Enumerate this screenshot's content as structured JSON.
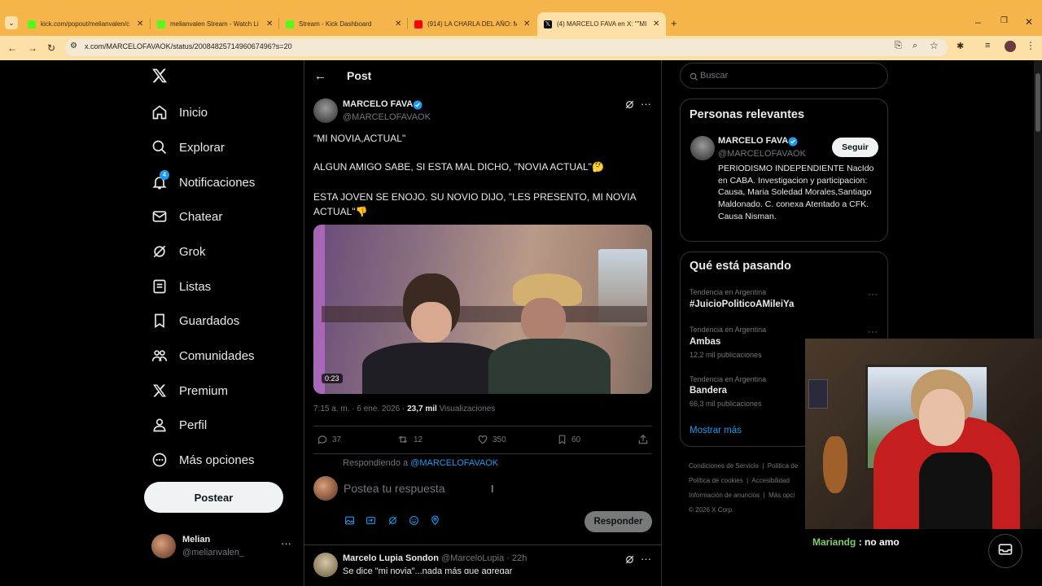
{
  "browser": {
    "tabs": [
      {
        "title": "kick.com/popout/melianvalen/c",
        "favicon": "kick"
      },
      {
        "title": "melianvalen Stream - Watch Li",
        "favicon": "kick"
      },
      {
        "title": "Stream - Kick Dashboard",
        "favicon": "kick"
      },
      {
        "title": "(914) LA CHARLA DEL AÑO: MI",
        "favicon": "youtube"
      },
      {
        "title": "(4) MARCELO FAVA en X: \"\"MI N",
        "favicon": "x"
      }
    ],
    "url": "x.com/MARCELOFAVAOK/status/2008482571496067496?s=20"
  },
  "sidebar": {
    "items": [
      {
        "label": "Inicio",
        "icon": "home-icon"
      },
      {
        "label": "Explorar",
        "icon": "search-icon"
      },
      {
        "label": "Notificaciones",
        "icon": "bell-icon",
        "badge": "4"
      },
      {
        "label": "Chatear",
        "icon": "mail-icon"
      },
      {
        "label": "Grok",
        "icon": "grok-icon"
      },
      {
        "label": "Listas",
        "icon": "list-icon"
      },
      {
        "label": "Guardados",
        "icon": "bookmark-icon"
      },
      {
        "label": "Comunidades",
        "icon": "communities-icon"
      },
      {
        "label": "Premium",
        "icon": "x-icon"
      },
      {
        "label": "Perfil",
        "icon": "profile-icon"
      },
      {
        "label": "Más opciones",
        "icon": "more-circle-icon"
      }
    ],
    "post_button": "Postear",
    "account": {
      "name": "Melian",
      "handle": "@melianvalen_"
    }
  },
  "main": {
    "header": "Post",
    "tweet": {
      "author": "MARCELO FAVA",
      "handle": "@MARCELOFAVAOK",
      "line1": "\"MI NOVIA,ACTUAL\"",
      "line2": "ALGUN AMIGO SABE, SI ESTA MAL DICHO, \"NOVIA ACTUAL\"🤔",
      "line3": "ESTA  JOVEN SE ENOJO. SU NOVIO DIJO, \"LES PRESENTO, MI NOVIA ACTUAL\"👎",
      "video_duration": "0:23",
      "timestamp": "7:15 a. m. · 6 ene. 2026 ·",
      "views_count": "23,7 mil",
      "views_label": "Visualizaciones",
      "replies": "37",
      "retweets": "12",
      "likes": "350",
      "bookmarks": "60"
    },
    "reply": {
      "replying_to_label": "Respondiendo a",
      "replying_to_handle": "@MARCELOFAVAOK",
      "placeholder": "Postea tu respuesta",
      "button": "Responder"
    },
    "next_reply": {
      "author": "Marcelo Lupia Sondon",
      "handle": "@MarceloLupia",
      "time": "· 22h",
      "text": "Se dice \"mi novia\"...nada más que agregar"
    }
  },
  "right": {
    "search_placeholder": "Buscar",
    "relevant": {
      "title": "Personas relevantes",
      "name": "MARCELO FAVA",
      "handle": "@MARCELOFAVAOK",
      "follow": "Seguir",
      "bio": "PERIODISMO INDEPENDIENTE NacIdo en CABA. Investigacion y participacion: Causa, Maria Soledad Morales,Santiago Maldonado. C. conexa Atentado a CFK. Causa Nisman."
    },
    "trends": {
      "title": "Qué está pasando",
      "items": [
        {
          "context": "Tendencia en Argentina",
          "name": "#JuicioPoliticoAMileiYa",
          "count": ""
        },
        {
          "context": "Tendencia en Argentina",
          "name": "Ambas",
          "count": "12,2 mil publicaciones"
        },
        {
          "context": "Tendencia en Argentina",
          "name": "Bandera",
          "count": "66,3 mil publicaciones"
        }
      ],
      "show_more": "Mostrar más"
    },
    "footer": {
      "l1a": "Condiciones de Servicio",
      "l1b": "Política de",
      "l2a": "Política de cookies",
      "l2b": "Accesibilidad",
      "l3a": "Información de anuncios",
      "l3b": "Más opci",
      "copyright": "© 2026 X Corp."
    }
  },
  "overlay": {
    "chat_user": "Mariandg",
    "chat_sep": ":",
    "chat_message": "no amo"
  },
  "colors": {
    "accent": "#1d9bf0",
    "tabbar": "#f6b54a",
    "chat_name": "#7fcc6a"
  }
}
